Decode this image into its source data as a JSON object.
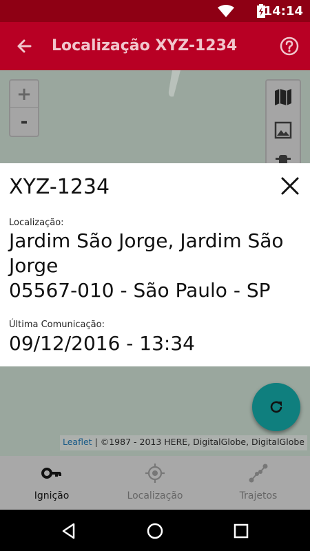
{
  "status_bar": {
    "time": "14:14"
  },
  "app_bar": {
    "title": "Localização XYZ-1234"
  },
  "map": {
    "zoom_in": "+",
    "zoom_out": "-",
    "attribution_link": "Leaflet",
    "attribution_text": " | ©1987 - 2013 HERE, DigitalGlobe, DigitalGlobe"
  },
  "card": {
    "title": "XYZ-1234",
    "location_label": "Localização:",
    "location_line1": "Jardim São Jorge, Jardim São Jorge",
    "location_line2": "05567-010 - São Paulo - SP",
    "last_comm_label": "Última Comunicação:",
    "last_comm_value": "09/12/2016 - 13:34"
  },
  "bottom_nav": {
    "items": [
      {
        "label": "Ignição",
        "icon": "key-icon",
        "active": true
      },
      {
        "label": "Localização",
        "icon": "crosshair-icon",
        "active": false
      },
      {
        "label": "Trajetos",
        "icon": "route-icon",
        "active": false
      }
    ]
  },
  "colors": {
    "app_bar": "#b80024",
    "status_bar": "#8e0014",
    "fab": "#0f7f7e"
  }
}
